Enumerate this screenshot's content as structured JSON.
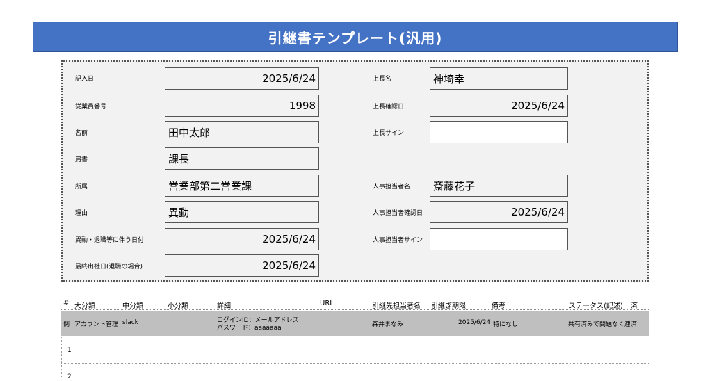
{
  "title": "引継書テンプレート(汎用)",
  "form": {
    "entry_date": {
      "label": "記入日",
      "value": "2025/6/24"
    },
    "employee_no": {
      "label": "従業員番号",
      "value": "1998"
    },
    "name": {
      "label": "名前",
      "value": "田中太郎"
    },
    "position": {
      "label": "肩書",
      "value": "課長"
    },
    "department": {
      "label": "所属",
      "value": "営業部第二営業課"
    },
    "reason": {
      "label": "理由",
      "value": "異動"
    },
    "transfer_date": {
      "label": "異動・退職等に伴う日付",
      "value": "2025/6/24"
    },
    "last_day": {
      "label": "最終出社日(退職の場合)",
      "value": "2025/6/24"
    },
    "boss_name": {
      "label": "上長名",
      "value": "神埼幸"
    },
    "boss_confirm_date": {
      "label": "上長確認日",
      "value": "2025/6/24"
    },
    "boss_sign": {
      "label": "上長サイン",
      "value": ""
    },
    "hr_name": {
      "label": "人事担当者名",
      "value": "斎藤花子"
    },
    "hr_confirm_date": {
      "label": "人事担当者確認日",
      "value": "2025/6/24"
    },
    "hr_sign": {
      "label": "人事担当者サイン",
      "value": ""
    }
  },
  "table": {
    "headers": [
      "#",
      "大分類",
      "中分類",
      "小分類",
      "詳細",
      "URL",
      "引継先担当者名",
      "引継ぎ期限",
      "備考",
      "ステータス(記述)",
      "済"
    ],
    "example": {
      "num": "例",
      "major": "アカウント管理",
      "middle": "slack",
      "detail_line1": "ログインID：メールアドレス",
      "detail_line2": "パスワード：aaaaaaa",
      "assignee": "森井まなみ",
      "deadline": "2025/6/24",
      "note": "特になし",
      "status": "共有済みで問題なく連",
      "done": "済"
    },
    "rows": [
      "1",
      "2"
    ]
  }
}
